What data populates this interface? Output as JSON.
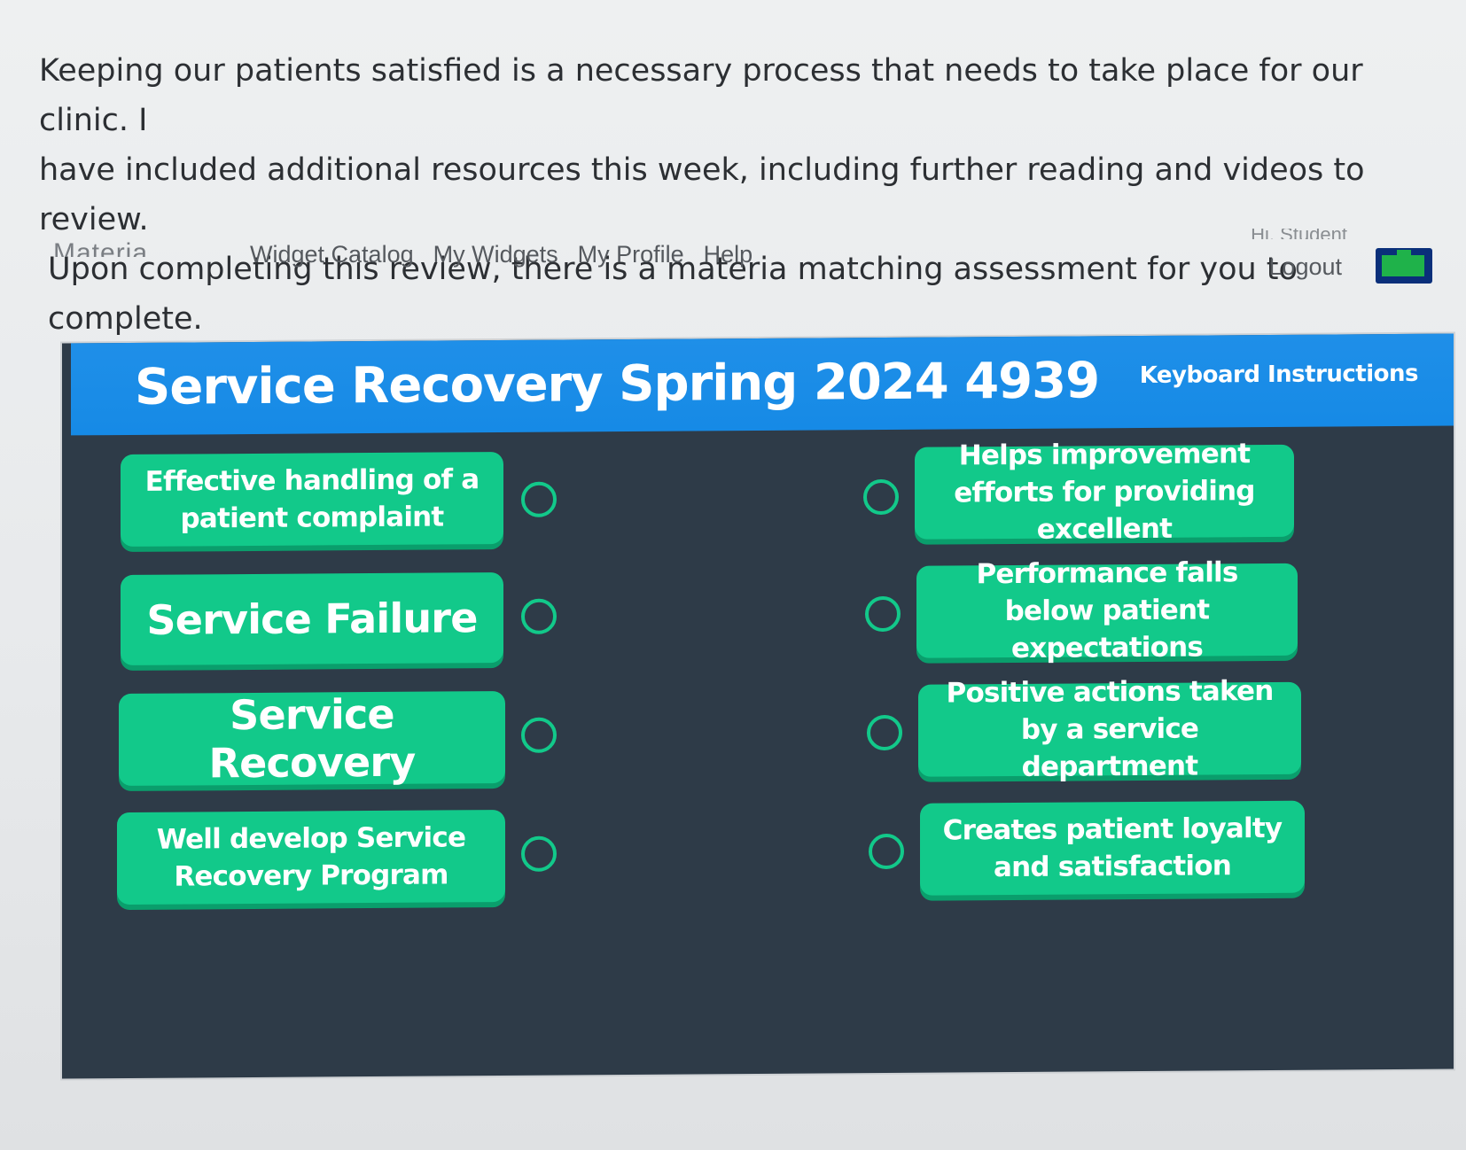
{
  "intro": {
    "line1": "Keeping our patients satisfied is a necessary process that needs to take place for our clinic.  I",
    "line2": "have included additional resources this week, including further reading and videos to review.",
    "line3": "Upon completing this review, there is a materia matching assessment for you to complete."
  },
  "nav": {
    "brand": "Materia",
    "links": [
      "Widget Catalog",
      "My Widgets",
      "My Profile",
      "Help"
    ],
    "user_line": "Hi, Student",
    "logout": "Logout"
  },
  "widget": {
    "title": "Service Recovery Spring 2024 4939",
    "keyboard_instructions": "Keyboard Instructions",
    "left_terms": [
      "Effective handling of a patient complaint",
      "Service Failure",
      "Service Recovery",
      "Well develop Service Recovery Program"
    ],
    "right_definitions": [
      "Helps improvement efforts for providing excellent",
      "Performance falls below patient expectations",
      "Positive actions taken by a service department",
      "Creates patient loyalty and satisfaction"
    ]
  },
  "colors": {
    "header_blue": "#168ae6",
    "card_green": "#12c98a",
    "panel_dark": "#2e3b48"
  }
}
